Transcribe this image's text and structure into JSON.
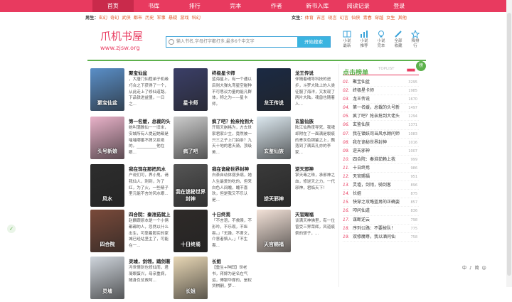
{
  "nav": [
    "首页",
    "书库",
    "排行",
    "完本",
    "作者",
    "新书入库",
    "阅读记录",
    "登录"
  ],
  "categories": {
    "male_label": "男生：",
    "male": [
      "玄幻",
      "奇幻",
      "武侠",
      "都市",
      "历史",
      "军事",
      "悬疑",
      "游戏",
      "科幻"
    ],
    "female_label": "女生：",
    "female": [
      "体育",
      "古言",
      "现言",
      "幻言",
      "仙侠",
      "青春",
      "穿越",
      "女生",
      "其他"
    ]
  },
  "logo": {
    "name": "爪机书屋",
    "url": "www.zjsw.org"
  },
  "search": {
    "placeholder": "输入书名,字母打字都打多,最多6个中文字",
    "button": "开始搜索"
  },
  "tools": [
    {
      "icon": "book-stack-icon",
      "label": "小说最新"
    },
    {
      "icon": "bar-chart-icon",
      "label": "小说推荐"
    },
    {
      "icon": "bulb-icon",
      "label": "小说完本"
    },
    {
      "icon": "pen-icon",
      "label": "全部收藏"
    },
    {
      "icon": "star-icon",
      "label": "降排行"
    }
  ],
  "books": [
    {
      "title": "聚宝仙盆",
      "desc": "，大唐门仙程弟子机缘巧合之下获得了一个，从此走上了修仙道路。下品铁进益盟，一日之...",
      "cover": "#5a8fc8",
      "cover_text": "聚宝仙盆"
    },
    {
      "title": "终极星卡师",
      "desc": "蓝海星上，有一个通以后则大弹丸弯星空碰种不可思议力量的能凡群体，称之为——星卡师。",
      "cover": "#3b3f68",
      "cover_text": "星卡师"
    },
    {
      "title": "龙王传说",
      "desc": "伴随着魂导科技的进步，斗罗大陆上的人类征服了海洋，又发现了两片大陆。魂兽也随着人...",
      "cover": "#1b2a44",
      "cover_text": "龙王传说"
    },
    {
      "title": "第一名媛，总裁的头",
      "desc": "她叫蒲雅仙一一旧米，安城所有人提起她都是嗤嗤哪番不屑又拒绝的。__________他在眼...",
      "cover": "#e9b2c9",
      "cover_text": "头号新娘"
    },
    {
      "title": "疯了吧？抢亲抢到大",
      "desc": "开局天崩格为，方去世家君家少主，竟然被一只三之子上门拍亲？九天十地的君天骑，顶级美...",
      "cover": "#cccccc",
      "cover_text": "疯了吧"
    },
    {
      "title": "玄鉴仙族",
      "desc": "陆江仙熬夜导死，我魂却附在了一面满是裂痕的青灰色铜鉴之上，飘落到了满高孔亦的李家...",
      "cover": "#dce8ef",
      "cover_text": "玄鉴仙族"
    },
    {
      "title": "我在现在那把风水",
      "desc": "户说们可，界小鬼，请我仙人，刺到，为了红，为了火，一些精子里元能不言的风水眼...",
      "cover": "#2d2d2d",
      "cover_text": "风水"
    },
    {
      "title": "我在诡秘世界封神",
      "desc": "白茶自幼体弱多病，她人生最爱的吃的，但来白色人间魄，魄不喜欢，但是我又不乐认是...",
      "cover": "#555555",
      "cover_text": "我在诡秘世界封神"
    },
    {
      "title": "逆天邪神",
      "desc": "掌天毒之珠，承邪神之血，修逆天之力，一代邪神，君临天下！",
      "cover": "#3a3a3a",
      "cover_text": "逆天邪神"
    },
    {
      "title": "四合院：秦淮茹就上",
      "desc": "赵麟跟原本是一个小俩都都的人，忽然以什么出生，可靠着股实的家城已经站坚主了，可能在一...",
      "cover": "#7a4a3a",
      "cover_text": "四合院"
    },
    {
      "title": "十日终焉",
      "desc": "「不言语，不救赎，不形吟，不乐观，不纵容。」「无躁，不肃文，介意者慎入。」「不生畏...",
      "cover": "#2e2a28",
      "cover_text": "十日终焉"
    },
    {
      "title": "天官赐福",
      "desc": "谈满天神佛里，有一位曾受三界荣辉，风道痕祭的骄子，...",
      "cover": "#f3e2d8",
      "cover_text": "天官赐福"
    },
    {
      "title": "灵墟，剑翎，踏剑著",
      "desc": "冯世情剑也修仙而，君凝眼蛋兴，母亲重病，随身负仗救阿...",
      "cover": "#cfd5dc",
      "cover_text": "灵墟"
    },
    {
      "title": "长姐",
      "desc": "【重生+种田】世老书，蒋嫁为是名在气运，傅银华撑的，是权贷棋嗣，梦...",
      "cover": "#e8d7b5",
      "cover_text": "长姐"
    }
  ],
  "rank": {
    "title": "点击榜单",
    "sub": "TOPLIST",
    "badge": "榜",
    "items": [
      {
        "n": "01.",
        "title": "聚宝仙盆",
        "v": "3295"
      },
      {
        "n": "02.",
        "title": "终极星卡师",
        "v": "1985"
      },
      {
        "n": "03.",
        "title": "龙王传说",
        "v": "1670"
      },
      {
        "n": "04.",
        "title": "第一名媛，总裁的头号新",
        "v": "1497"
      },
      {
        "n": "05.",
        "title": "疯了吧？抢亲抢到大佬头",
        "v": "1294"
      },
      {
        "n": "06.",
        "title": "玄鉴仙族",
        "v": "1371"
      },
      {
        "n": "07.",
        "title": "我在镇妖司当风水顾问师",
        "v": "1083"
      },
      {
        "n": "08.",
        "title": "我在诡秘世界封神",
        "v": "1016"
      },
      {
        "n": "09.",
        "title": "逆天邪神",
        "v": "1007"
      },
      {
        "n": "10.",
        "title": "四合院：秦淮茹赖上我",
        "v": "999"
      },
      {
        "n": "11.",
        "title": "十日终焉",
        "v": "986"
      },
      {
        "n": "12.",
        "title": "天官赐福",
        "v": "951"
      },
      {
        "n": "13.",
        "title": "灵墟，剑翎，骑剑客",
        "v": "896"
      },
      {
        "n": "14.",
        "title": "长姐",
        "v": "875"
      },
      {
        "n": "15.",
        "title": "快穿之攻略蓝男的正确姿",
        "v": "857"
      },
      {
        "n": "16.",
        "title": "叩问仙道",
        "v": "836"
      },
      {
        "n": "17.",
        "title": "谋断逆云",
        "v": "798"
      },
      {
        "n": "18.",
        "title": "序列公路：不要掉队！",
        "v": "775"
      },
      {
        "n": "19.",
        "title": "双修魔尊，我以酒问仙",
        "v": "758"
      }
    ]
  },
  "ime": "中 ♪ 简 ☺"
}
